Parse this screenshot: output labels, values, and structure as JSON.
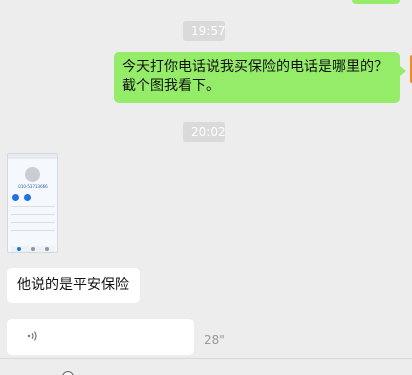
{
  "timestamps": [
    "19:57",
    "20:02"
  ],
  "messages": {
    "outgoing": "今天打你电话说我买保险的电话是哪里的？截个图我看下。",
    "incoming_text": "他说的是平安保险",
    "voice_duration": "28\""
  },
  "screenshot_image": {
    "phone_number": "010-53713666"
  },
  "colors": {
    "background": "#ededed",
    "outgoing_bubble": "#95ec69",
    "incoming_bubble": "#ffffff",
    "timestamp": "#dadada"
  },
  "icons": {
    "voice": "voice-wave-icon"
  }
}
